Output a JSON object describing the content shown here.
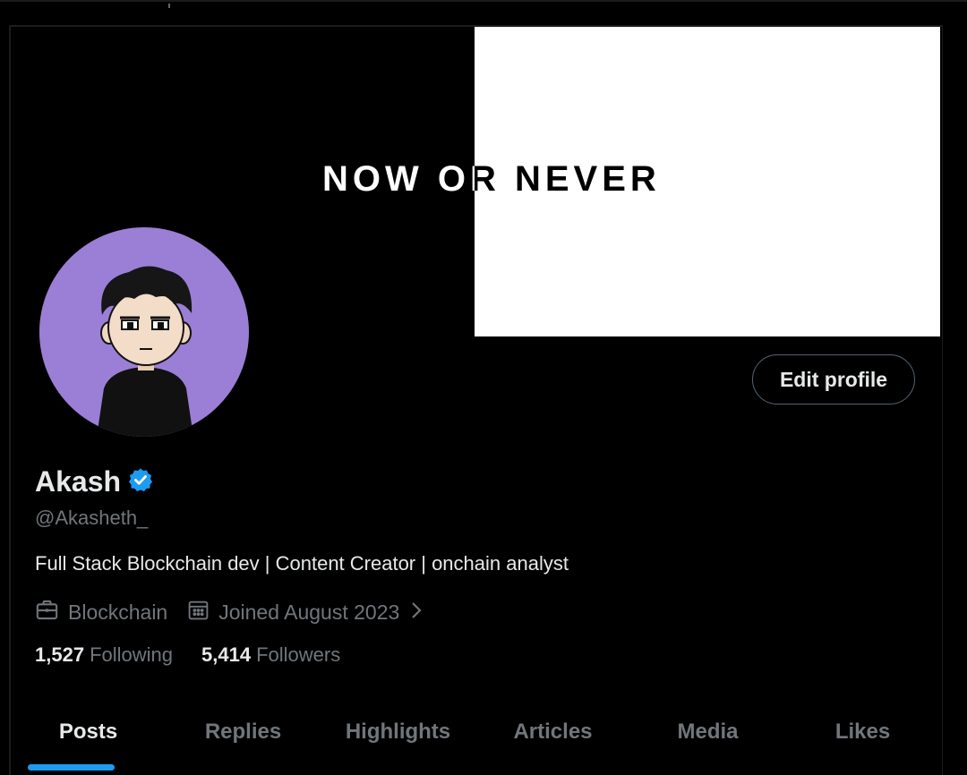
{
  "banner": {
    "text": "NOW OR NEVER"
  },
  "profile": {
    "name": "Akash",
    "handle": "@Akasheth_",
    "bio": "Full Stack Blockchain dev | Content Creator | onchain analyst",
    "category": "Blockchain",
    "joined": "Joined August 2023",
    "following_count": "1,527",
    "following_label": "Following",
    "followers_count": "5,414",
    "followers_label": "Followers",
    "verified": true
  },
  "actions": {
    "edit_profile": "Edit profile"
  },
  "tabs": [
    {
      "label": "Posts",
      "active": true
    },
    {
      "label": "Replies"
    },
    {
      "label": "Highlights"
    },
    {
      "label": "Articles"
    },
    {
      "label": "Media"
    },
    {
      "label": "Likes"
    }
  ],
  "colors": {
    "accent": "#1d9bf0",
    "avatar_bg": "#9b7fd6",
    "muted": "#71767b",
    "background": "#000000"
  },
  "icons": [
    "verified-badge-icon",
    "briefcase-icon",
    "calendar-icon",
    "chevron-right-icon"
  ]
}
